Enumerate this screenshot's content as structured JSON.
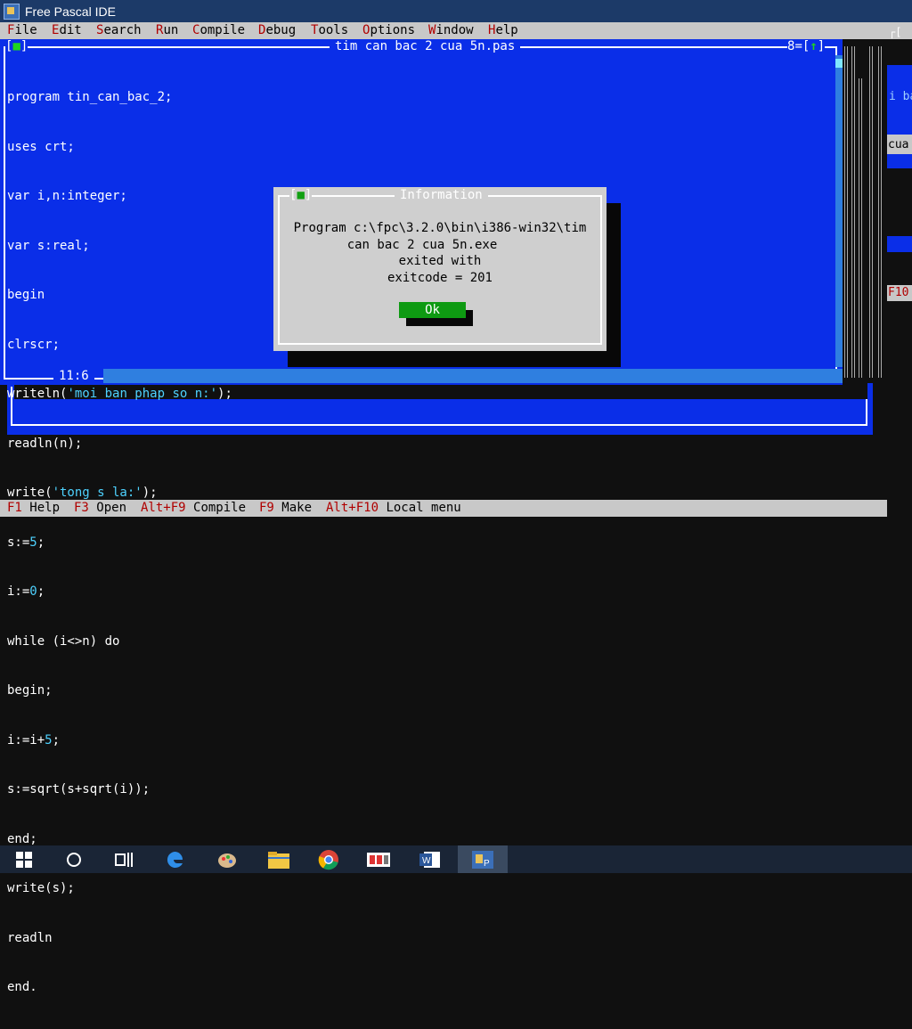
{
  "window": {
    "title": "Free Pascal IDE"
  },
  "menu": {
    "items": [
      {
        "hot": "F",
        "rest": "ile"
      },
      {
        "hot": "E",
        "rest": "dit"
      },
      {
        "hot": "S",
        "rest": "earch"
      },
      {
        "hot": "R",
        "rest": "un"
      },
      {
        "hot": "C",
        "rest": "ompile"
      },
      {
        "hot": "D",
        "rest": "ebug"
      },
      {
        "hot": "T",
        "rest": "ools"
      },
      {
        "hot": "O",
        "rest": "ptions"
      },
      {
        "hot": "W",
        "rest": "indow"
      },
      {
        "hot": "H",
        "rest": "elp"
      }
    ]
  },
  "editor": {
    "title": "tim can bac 2 cua 5n.pas",
    "window_number": "8",
    "cursor_position": "11:6",
    "close_marker": "■",
    "zoom_marker": "↑",
    "code": [
      "program tin_can_bac_2;",
      "uses crt;",
      "var i,n:integer;",
      "var s:real;",
      "begin",
      "clrscr;",
      "writeln('moi ban phap so n:');",
      "readln(n);",
      "write('tong s la:');",
      "s:=5;",
      "i:=0;",
      "while (i<>n) do",
      "begin;",
      "i:=i+5;",
      "s:=sqrt(s+sqrt(i));",
      "end;",
      "write(s);",
      "readln",
      "end."
    ]
  },
  "dialog": {
    "title": "Information",
    "close_marker": "■",
    "lines": [
      "Program c:\\fpc\\3.2.0\\bin\\i386-win32\\tim",
      "can bac 2 cua 5n.exe",
      "exited with",
      "exitcode = 201"
    ],
    "ok_label": "Ok"
  },
  "background_window_fragments": [
    "i ba",
    "cua",
    "F10"
  ],
  "status": {
    "items": [
      {
        "key": "F1",
        "label": "Help"
      },
      {
        "key": "F3",
        "label": "Open"
      },
      {
        "key": "Alt+F9",
        "label": "Compile"
      },
      {
        "key": "F9",
        "label": "Make"
      },
      {
        "key": "Alt+F10",
        "label": "Local menu"
      }
    ]
  },
  "taskbar": {
    "icons": [
      "windows-start-icon",
      "cortana-search-icon",
      "task-view-icon",
      "edge-icon",
      "paint-icon",
      "file-explorer-icon",
      "chrome-icon",
      "media-app-icon",
      "word-icon",
      "free-pascal-icon"
    ]
  },
  "colors": {
    "editor_bg": "#0a2ee8",
    "menu_bg": "#c8c8c8",
    "hotkey": "#b00000",
    "string_literal": "#4ed2ff",
    "dialog_bg": "#cfcfcf",
    "ok_button": "#0e9a12"
  }
}
